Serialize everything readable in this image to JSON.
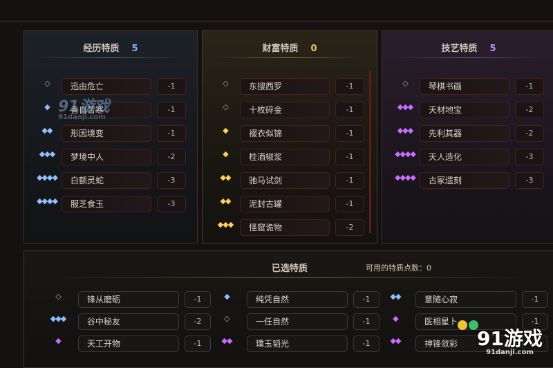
{
  "panels": {
    "experience": {
      "title": "经历特质",
      "count": "5",
      "count_color": "#7fb2ff",
      "items": [
        {
          "gem": "◇",
          "gem_type": "outline",
          "name": "迅由危亡",
          "cost": "-1"
        },
        {
          "gem": "◆",
          "gem_type": "blue",
          "name": "香自苦寒",
          "cost": "-1"
        },
        {
          "gem": "◆◆",
          "gem_type": "blue",
          "name": "形因境变",
          "cost": "-1"
        },
        {
          "gem": "◆◆◆",
          "gem_type": "blue",
          "name": "梦境中人",
          "cost": "-2"
        },
        {
          "gem": "◆◆◆◆",
          "gem_type": "blue",
          "name": "白额灵蛇",
          "cost": "-3"
        },
        {
          "gem": "◆◆◆◆",
          "gem_type": "blue",
          "name": "服芝食玉",
          "cost": "-3"
        }
      ]
    },
    "wealth": {
      "title": "财富特质",
      "count": "0",
      "count_color": "#e8c46a",
      "items": [
        {
          "gem": "◇",
          "gem_type": "outline",
          "name": "东搜西罗",
          "cost": "-1"
        },
        {
          "gem": "◇",
          "gem_type": "outline",
          "name": "十枚碎金",
          "cost": "-1"
        },
        {
          "gem": "◆",
          "gem_type": "gold",
          "name": "裰衣似锦",
          "cost": "-1"
        },
        {
          "gem": "◆",
          "gem_type": "gold",
          "name": "桂酒椒浆",
          "cost": "-1"
        },
        {
          "gem": "◆◆",
          "gem_type": "gold",
          "name": "驰马试剑",
          "cost": "-1"
        },
        {
          "gem": "◆◆",
          "gem_type": "gold",
          "name": "泥封古罐",
          "cost": "-1"
        },
        {
          "gem": "◆◆◆",
          "gem_type": "gold",
          "name": "怪窟诡物",
          "cost": "-2"
        }
      ]
    },
    "skill": {
      "title": "技艺特质",
      "count": "5",
      "count_color": "#c98cff",
      "items": [
        {
          "gem": "◇",
          "gem_type": "outline",
          "name": "琴棋书画",
          "cost": "-1"
        },
        {
          "gem": "◆◆◆",
          "gem_type": "purple",
          "name": "天材地宝",
          "cost": "-2"
        },
        {
          "gem": "◆◆◆",
          "gem_type": "purple",
          "name": "先利其器",
          "cost": "-2"
        },
        {
          "gem": "◆◆◆◆",
          "gem_type": "purple",
          "name": "天人造化",
          "cost": "-3"
        },
        {
          "gem": "◆◆◆◆",
          "gem_type": "purple",
          "name": "古冢遗刻",
          "cost": "-3"
        }
      ]
    }
  },
  "selected": {
    "title": "已选特质",
    "points_label": "可用的特质点数：0",
    "items": [
      {
        "gem": "◇",
        "gem_type": "outline",
        "name": "锋从磨砺",
        "cost": "-1"
      },
      {
        "gem": "◆",
        "gem_type": "blue",
        "name": "纯凭自然",
        "cost": "-1"
      },
      {
        "gem": "◆◆",
        "gem_type": "blue",
        "name": "意随心寂",
        "cost": "-1"
      },
      {
        "gem": "◆◆◆",
        "gem_type": "blue",
        "name": "谷中秘友",
        "cost": "-2"
      },
      {
        "gem": "◇",
        "gem_type": "outline",
        "name": "一任自然",
        "cost": "-1"
      },
      {
        "gem": "◆",
        "gem_type": "purple",
        "name": "医相星卜",
        "cost": "-1"
      },
      {
        "gem": "◆",
        "gem_type": "purple",
        "name": "天工开物",
        "cost": "-1"
      },
      {
        "gem": "◆◆",
        "gem_type": "purple",
        "name": "璞玉韬光",
        "cost": "-1"
      },
      {
        "gem": "◆◆",
        "gem_type": "purple",
        "name": "神锋敛彩",
        "cost": "-1"
      }
    ]
  },
  "watermarks": {
    "top_logo": "91游戏",
    "top_url": "91danji.com",
    "bottom_logo": "91游戏",
    "bottom_url": "91danji.com"
  }
}
